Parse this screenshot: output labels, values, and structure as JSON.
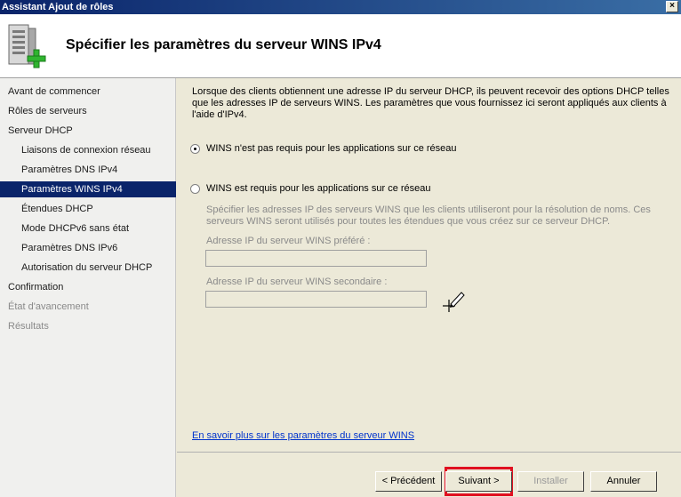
{
  "window": {
    "title": "Assistant Ajout de rôles",
    "close_label": "×"
  },
  "header": {
    "title": "Spécifier les paramètres du serveur WINS IPv4",
    "icon": "server-add-icon"
  },
  "sidebar": {
    "items": [
      {
        "label": "Avant de commencer",
        "level": 0,
        "state": "normal"
      },
      {
        "label": "Rôles de serveurs",
        "level": 0,
        "state": "normal"
      },
      {
        "label": "Serveur DHCP",
        "level": 0,
        "state": "normal"
      },
      {
        "label": "Liaisons de connexion réseau",
        "level": 1,
        "state": "normal"
      },
      {
        "label": "Paramètres DNS IPv4",
        "level": 1,
        "state": "normal"
      },
      {
        "label": "Paramètres WINS IPv4",
        "level": 1,
        "state": "active"
      },
      {
        "label": "Étendues DHCP",
        "level": 1,
        "state": "normal"
      },
      {
        "label": "Mode DHCPv6 sans état",
        "level": 1,
        "state": "normal"
      },
      {
        "label": "Paramètres DNS IPv6",
        "level": 1,
        "state": "normal"
      },
      {
        "label": "Autorisation du serveur DHCP",
        "level": 1,
        "state": "normal"
      },
      {
        "label": "Confirmation",
        "level": 0,
        "state": "normal"
      },
      {
        "label": "État d'avancement",
        "level": 0,
        "state": "disabled"
      },
      {
        "label": "Résultats",
        "level": 0,
        "state": "disabled"
      }
    ]
  },
  "content": {
    "intro": "Lorsque des clients obtiennent une adresse IP du serveur DHCP, ils peuvent recevoir des options DHCP telles que les adresses IP de serveurs WINS. Les paramètres que vous fournissez ici seront appliqués aux clients à l'aide d'IPv4.",
    "option_not_required": {
      "label": "WINS n'est pas requis pour les applications sur ce réseau",
      "checked": true
    },
    "option_required": {
      "label": "WINS est requis pour les applications sur ce réseau",
      "checked": false
    },
    "required_desc": "Spécifier les adresses IP des serveurs WINS que les clients utiliseront pour la résolution de noms. Ces serveurs WINS seront utilisés pour toutes les étendues que vous créez sur ce serveur DHCP.",
    "preferred_label": "Adresse IP du serveur WINS préféré :",
    "preferred_value": "",
    "alternate_label": "Adresse IP du serveur WINS secondaire :",
    "alternate_value": "",
    "help_link": "En savoir plus sur les paramètres du serveur WINS"
  },
  "footer": {
    "prev_label": "< Précédent",
    "next_label": "Suivant >",
    "install_label": "Installer",
    "cancel_label": "Annuler"
  },
  "colors": {
    "selection": "#0a246a",
    "highlight": "#e01020",
    "link": "#0033cc"
  }
}
